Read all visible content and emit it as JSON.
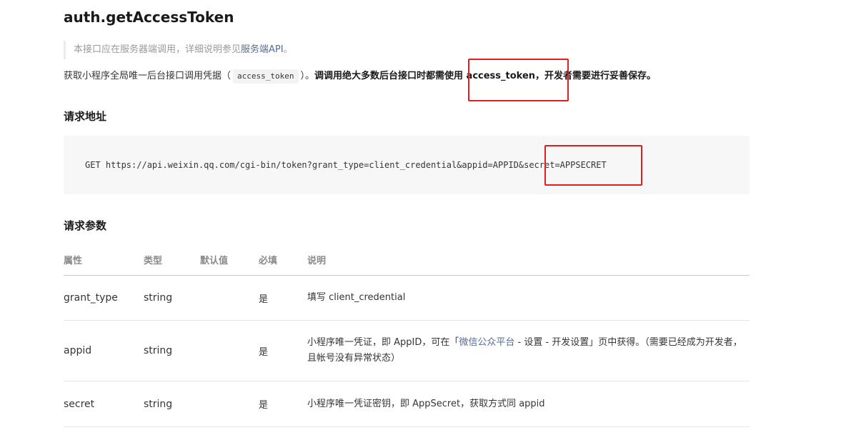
{
  "doc": {
    "title": "auth.getAccessToken",
    "note": {
      "prefix": "本接口应在服务器端调用，详细说明参见",
      "link": "服务端API",
      "suffix": "。"
    },
    "desc": {
      "part1": "获取小程序全局唯一后台接口调用凭据（",
      "code": "access_token",
      "part2": "）。",
      "bold": "调调用绝大多数后台接口时都需使用 access_token，开发者需要进行妥善保存。"
    }
  },
  "sections": {
    "url_title": "请求地址",
    "params_title": "请求参数"
  },
  "request": {
    "url": "GET https://api.weixin.qq.com/cgi-bin/token?grant_type=client_credential&appid=APPID&secret=APPSECRET"
  },
  "table": {
    "headers": [
      "属性",
      "类型",
      "默认值",
      "必填",
      "说明"
    ],
    "rows": [
      {
        "name": "grant_type",
        "type": "string",
        "default": "",
        "required": "是",
        "desc": "填写 client_credential"
      },
      {
        "name": "appid",
        "type": "string",
        "default": "",
        "required": "是",
        "desc_prefix": "小程序唯一凭证，即 AppID，可在「",
        "desc_link": "微信公众平台",
        "desc_suffix": " - 设置 - 开发设置」页中获得。（需要已经成为开发者，且帐号没有异常状态）"
      },
      {
        "name": "secret",
        "type": "string",
        "default": "",
        "required": "是",
        "desc": "小程序唯一凭证密钥，即 AppSecret，获取方式同 appid"
      }
    ]
  },
  "colors": {
    "text": "#353535",
    "link": "#576b95",
    "muted": "#9a9a9a",
    "code_bg": "#f7f7f7",
    "highlight": "#e02020"
  }
}
